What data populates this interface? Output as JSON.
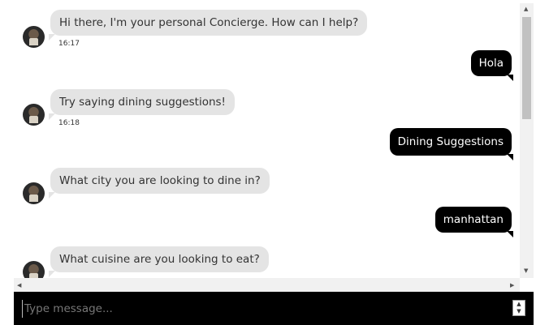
{
  "chat": {
    "messages": [
      {
        "role": "bot",
        "text": "Hi there, I'm your personal Concierge. How can I help?",
        "time": "16:17"
      },
      {
        "role": "user",
        "text": "Hola"
      },
      {
        "role": "bot",
        "text": "Try saying dining suggestions!",
        "time": "16:18"
      },
      {
        "role": "user",
        "text": "Dining Suggestions"
      },
      {
        "role": "bot",
        "text": "What city you are looking to dine in?"
      },
      {
        "role": "user",
        "text": "manhattan"
      },
      {
        "role": "bot",
        "text": "What cuisine are you looking to eat?"
      }
    ]
  },
  "input": {
    "placeholder": "Type message..."
  },
  "icons": {
    "avatar": "bot-avatar-photo",
    "scroll_up": "triangle-up",
    "scroll_down": "triangle-down",
    "scroll_left": "triangle-left",
    "scroll_right": "triangle-right"
  },
  "colors": {
    "bot_bubble": "#e4e4e4",
    "user_bubble": "#000000",
    "input_bar": "#000000"
  }
}
